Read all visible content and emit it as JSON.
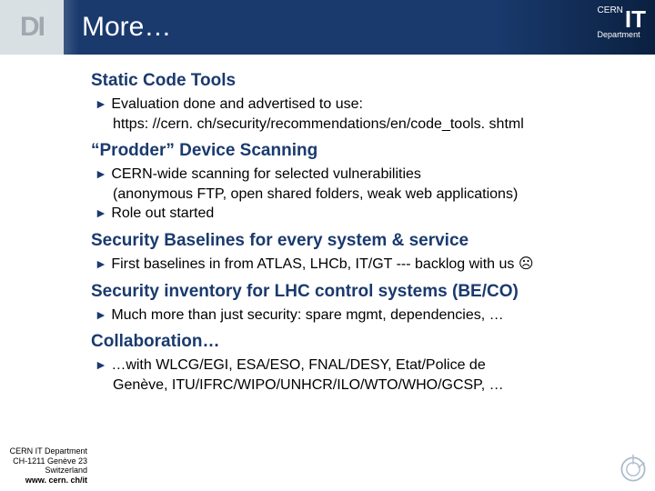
{
  "header": {
    "badge": "DI",
    "title": "More…",
    "logo_prefix": "CERN",
    "logo_main": "IT",
    "logo_sub": "Department"
  },
  "sections": [
    {
      "title": "Static Code Tools",
      "bullets": [
        "Evaluation done and advertised to use:",
        "https: //cern. ch/security/recommendations/en/code_tools. shtml"
      ]
    },
    {
      "title": "“Prodder” Device Scanning",
      "bullets": [
        "CERN-wide scanning for selected vulnerabilities",
        "(anonymous FTP, open shared folders, weak web applications)",
        "Role out started"
      ]
    },
    {
      "title": "Security Baselines for every system & service",
      "bullets": [
        "First baselines in from ATLAS, LHCb, IT/GT --- backlog with us ☹"
      ]
    },
    {
      "title": "Security inventory for LHC control systems (BE/CO)",
      "bullets": [
        "Much more than just security: spare mgmt, dependencies, …"
      ]
    },
    {
      "title": "Collaboration…",
      "bullets": [
        "…with WLCG/EGI, ESA/ESO, FNAL/DESY, Etat/Police de",
        "Genève, ITU/IFRC/WIPO/UNHCR/ILO/WTO/WHO/GCSP, …"
      ]
    }
  ],
  "footer": {
    "line1": "CERN IT Department",
    "line2": "CH-1211 Genève 23",
    "line3": "Switzerland",
    "line4": "www. cern. ch/it"
  }
}
